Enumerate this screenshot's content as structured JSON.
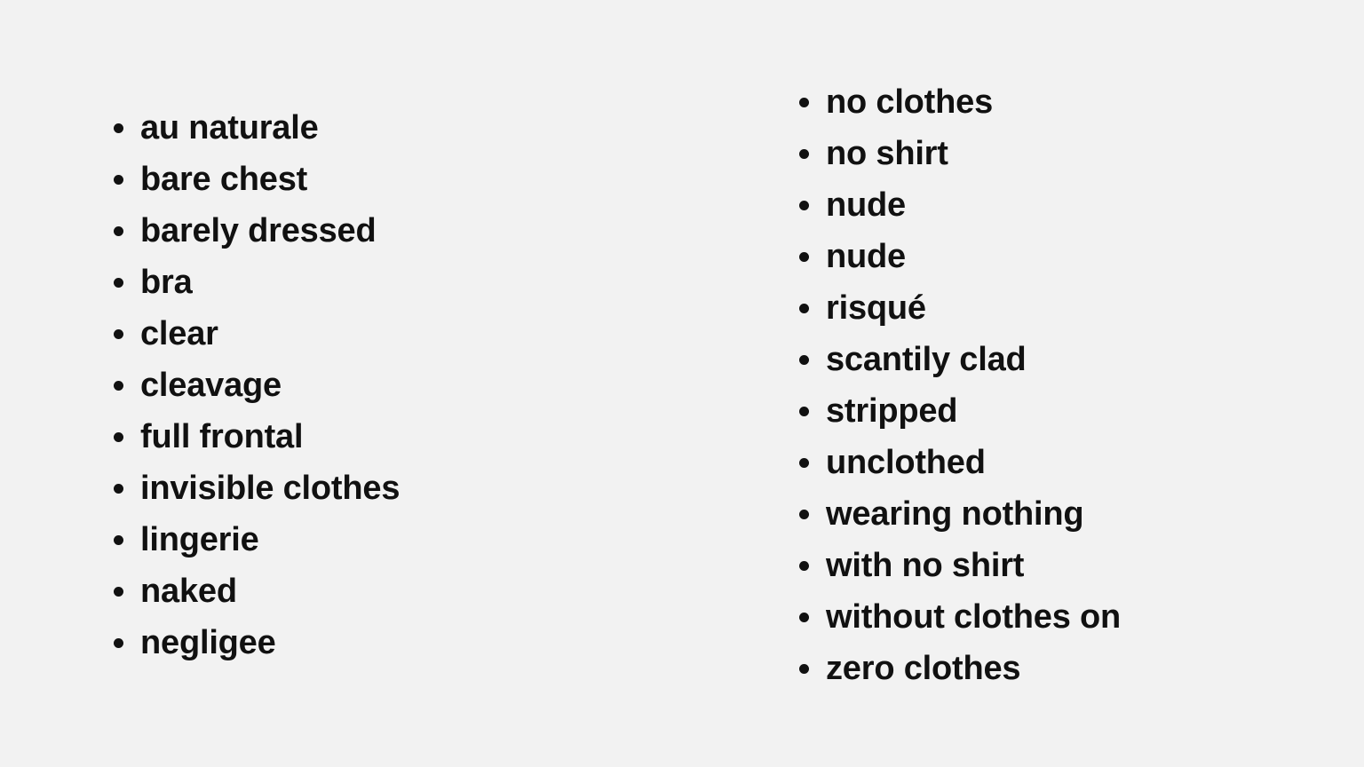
{
  "background_color": "#f2f2f2",
  "text_color": "#111111",
  "bullet_color": "#111111",
  "columns": [
    {
      "name": "left-column",
      "items": [
        {
          "label": "au naturale"
        },
        {
          "label": "bare chest"
        },
        {
          "label": "barely dressed"
        },
        {
          "label": "bra"
        },
        {
          "label": "clear"
        },
        {
          "label": "cleavage"
        },
        {
          "label": "full frontal"
        },
        {
          "label": "invisible clothes"
        },
        {
          "label": "lingerie"
        },
        {
          "label": "naked"
        },
        {
          "label": "negligee"
        }
      ]
    },
    {
      "name": "right-column",
      "items": [
        {
          "label": "no clothes"
        },
        {
          "label": "no shirt"
        },
        {
          "label": "nude"
        },
        {
          "label": "nude"
        },
        {
          "label": "risqué"
        },
        {
          "label": "scantily clad"
        },
        {
          "label": "stripped"
        },
        {
          "label": "unclothed"
        },
        {
          "label": "wearing nothing"
        },
        {
          "label": "with no shirt"
        },
        {
          "label": "without clothes on"
        },
        {
          "label": "zero clothes"
        }
      ]
    }
  ]
}
